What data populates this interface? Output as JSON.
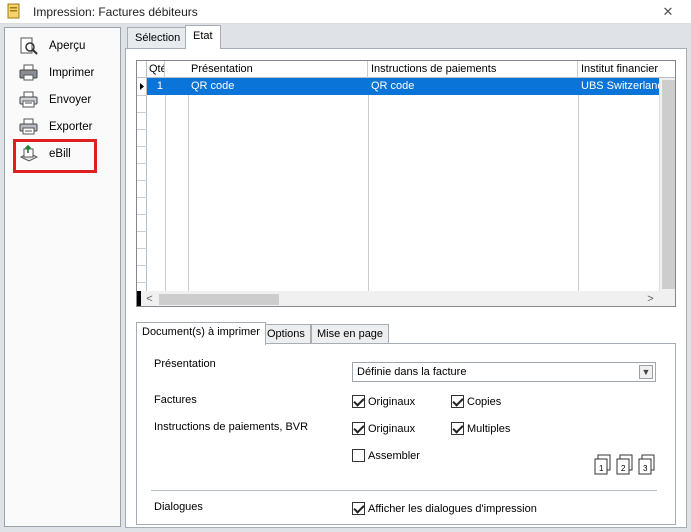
{
  "window": {
    "title": "Impression: Factures débiteurs",
    "close_symbol": "✕"
  },
  "sidebar": {
    "items": [
      {
        "label": "Aperçu",
        "icon": "preview-icon"
      },
      {
        "label": "Imprimer",
        "icon": "printer-icon"
      },
      {
        "label": "Envoyer",
        "icon": "send-icon"
      },
      {
        "label": "Exporter",
        "icon": "export-icon"
      },
      {
        "label": "eBill",
        "icon": "ebill-icon"
      }
    ],
    "highlight_color": "#e02020"
  },
  "tabs": [
    "Sélection",
    "Etat"
  ],
  "active_tab": "Etat",
  "grid": {
    "columns": [
      "Qté",
      "Présentation",
      "Instructions de paiements",
      "Institut financier"
    ],
    "rows": [
      {
        "qty": "1",
        "presentation": "QR code",
        "instructions": "QR code",
        "institute": "UBS Switzerland"
      }
    ],
    "selected_row_color": "#0a74d8"
  },
  "subtabs": [
    "Document(s) à imprimer",
    "Options",
    "Mise en page"
  ],
  "form": {
    "presentation_label": "Présentation",
    "presentation_value": "Définie dans la facture",
    "factures_label": "Factures",
    "instructions_label": "Instructions de paiements, BVR",
    "dialogues_label": "Dialogues",
    "checks": {
      "factures_originaux": {
        "label": "Originaux",
        "checked": true
      },
      "factures_copies": {
        "label": "Copies",
        "checked": true
      },
      "instr_originaux": {
        "label": "Originaux",
        "checked": true
      },
      "instr_multiples": {
        "label": "Multiples",
        "checked": true
      },
      "assembler": {
        "label": "Assembler",
        "checked": false
      },
      "dialogues": {
        "label": "Afficher les dialogues d'impression",
        "checked": true
      }
    }
  }
}
